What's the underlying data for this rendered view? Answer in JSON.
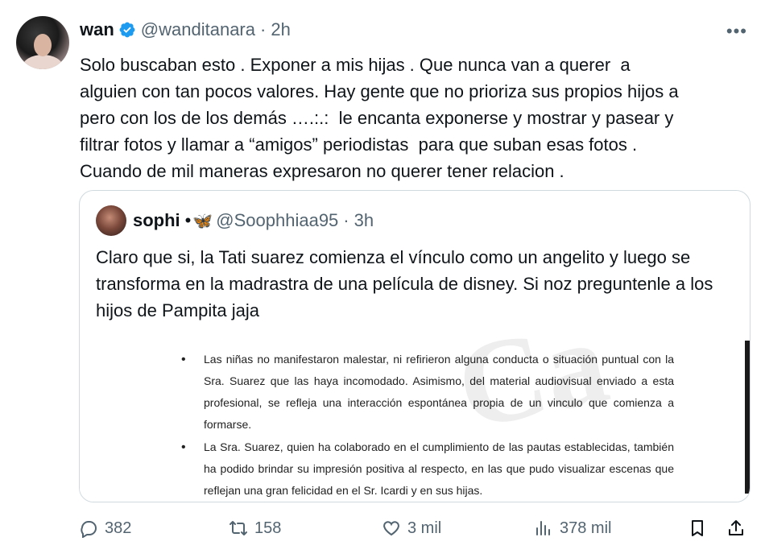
{
  "tweet": {
    "author_name": "wan",
    "handle": "@wanditanara",
    "time": "2h",
    "separator": "·",
    "more": "•••",
    "text": "Solo buscaban esto . Exponer a mis hijas . Que nunca van a querer  a\nalguien con tan pocos valores. Hay gente que no prioriza sus propios hijos a\npero con los de los demás ….:.:  le encanta exponerse y mostrar y pasear y\nfiltrar fotos y llamar a “amigos” periodistas  para que suban esas fotos .\nCuando de mil maneras expresaron no querer tener relacion ."
  },
  "quote": {
    "author_name": "sophi",
    "bullet": "•",
    "emoji": "🦋",
    "handle": "@Soophhiaa95",
    "time": "3h",
    "separator": "·",
    "text": "Claro que si, la Tati suarez comienza el vínculo como un angelito y luego se transforma en la madrastra de una película de disney. Si noz preguntenle a los hijos de Pampita jaja",
    "document": {
      "watermark": "Ca",
      "bullets": [
        "Las niñas no manifestaron malestar, ni refirieron alguna conducta o situación puntual con la Sra. Suarez que las haya incomodado. Asimismo, del material audiovisual enviado a esta profesional, se refleja una interacción espontánea propia de un vinculo que comienza a formarse.",
        "La Sra. Suarez, quien ha colaborado en el cumplimiento de las pautas establecidas, también ha podido brindar su impresión positiva al respecto, en las que pudo visualizar escenas que reflejan una gran felicidad en el Sr. Icardi y en sus hijas."
      ]
    }
  },
  "actions": {
    "replies": "382",
    "reposts": "158",
    "likes": "3 mil",
    "views": "378 mil"
  },
  "colors": {
    "text": "#0f1419",
    "secondary": "#536471",
    "verified": "#1d9bf0",
    "border": "#cfd9de"
  }
}
